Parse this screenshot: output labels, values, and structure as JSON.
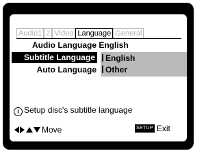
{
  "tabs": [
    {
      "label": "Audio1",
      "active": false
    },
    {
      "label": "2",
      "active": false
    },
    {
      "label": "Video",
      "active": false
    },
    {
      "label": "Language",
      "active": true
    },
    {
      "label": "General",
      "active": false
    }
  ],
  "settings": {
    "audio_language": {
      "label": "Audio Language",
      "value": "English"
    },
    "subtitle_language": {
      "label": "Subtitle Language"
    },
    "auto_language": {
      "label": "Auto Language"
    }
  },
  "options": [
    "English",
    "Other"
  ],
  "info": {
    "icon": "info-icon",
    "text": "Setup disc's subtitle language"
  },
  "footer": {
    "move_label": "Move",
    "setup_badge": "SETUP",
    "exit_label": "Exit"
  },
  "colors": {
    "screen": "#000000",
    "highlight": "#000000",
    "options_bg": "#b9b9b9",
    "inactive_tab": "#b0b0b0"
  }
}
